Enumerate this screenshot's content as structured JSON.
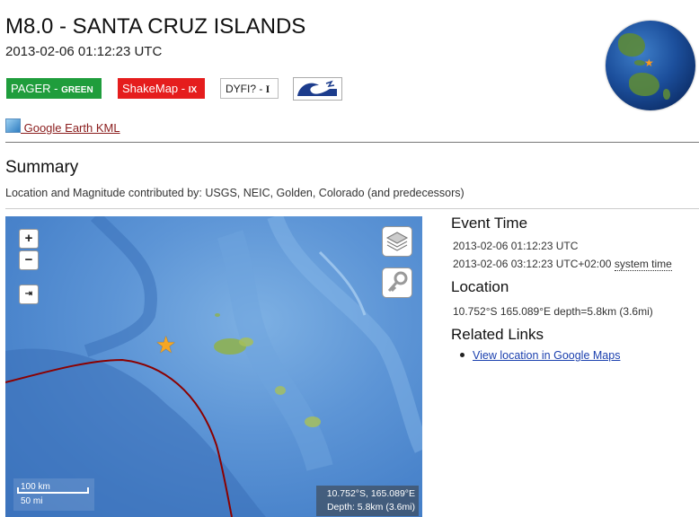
{
  "header": {
    "title": "M8.0 - SANTA CRUZ ISLANDS",
    "datetime": "2013-02-06 01:12:23 UTC"
  },
  "badges": {
    "pager_prefix": "PAGER - ",
    "pager_level": "GREEN",
    "shakemap_prefix": "ShakeMap - ",
    "shakemap_level": "IX",
    "dyfi_prefix": "DYFI? - ",
    "dyfi_level": "I",
    "tsunami_icon": "tsunami-wave-icon"
  },
  "kml": {
    "label": " Google Earth KML",
    "icon": "google-earth-icon"
  },
  "summary": {
    "heading": "Summary",
    "contributed": "Location and Magnitude contributed by: USGS, NEIC, Golden, Colorado (and predecessors)"
  },
  "map": {
    "zoom_in": "+",
    "zoom_out": "−",
    "fit": "⇥",
    "scale_km": "100 km",
    "scale_mi": "50 mi",
    "coord_line1": "10.752°S, 165.089°E",
    "coord_line2": "Depth: 5.8km (3.6mi)"
  },
  "event": {
    "time_heading": "Event Time",
    "time_utc": "2013-02-06 01:12:23 UTC",
    "time_local": "2013-02-06 03:12:23 UTC+02:00",
    "system_time": "system time",
    "location_heading": "Location",
    "location_value": "10.752°S 165.089°E depth=5.8km (3.6mi)",
    "links_heading": "Related Links",
    "link_google_maps": "View location in Google Maps"
  },
  "colors": {
    "pager_green": "#1f9d3c",
    "shakemap_red": "#e51d1d",
    "link_blue": "#1a3fae",
    "kml_link": "#8a1c1c",
    "plate_boundary": "#8b0000",
    "epicenter_star": "#f5a623"
  }
}
